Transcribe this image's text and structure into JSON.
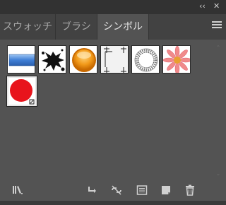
{
  "window": {
    "collapse_label": "‹‹",
    "close_label": "✕"
  },
  "tabs": [
    {
      "label": "スウォッチ",
      "active": false
    },
    {
      "label": "ブラシ",
      "active": false
    },
    {
      "label": "シンボル",
      "active": true
    }
  ],
  "symbols": [
    {
      "name": "blue-gradient-bar-symbol"
    },
    {
      "name": "black-ink-splat-symbol"
    },
    {
      "name": "orange-orb-symbol"
    },
    {
      "name": "crop-marks-symbol"
    },
    {
      "name": "dotted-ring-symbol"
    },
    {
      "name": "pink-flower-symbol"
    },
    {
      "name": "red-circle-symbol",
      "selected": true
    }
  ],
  "footer_icons": [
    "symbol-libraries-menu-icon",
    "place-symbol-instance-icon",
    "break-link-icon",
    "symbol-options-icon",
    "new-symbol-icon",
    "delete-symbol-icon"
  ],
  "colors": {
    "panel_bg": "#535353",
    "tab_bar_bg": "#424242",
    "selected_symbol_fill": "#e8141c"
  }
}
